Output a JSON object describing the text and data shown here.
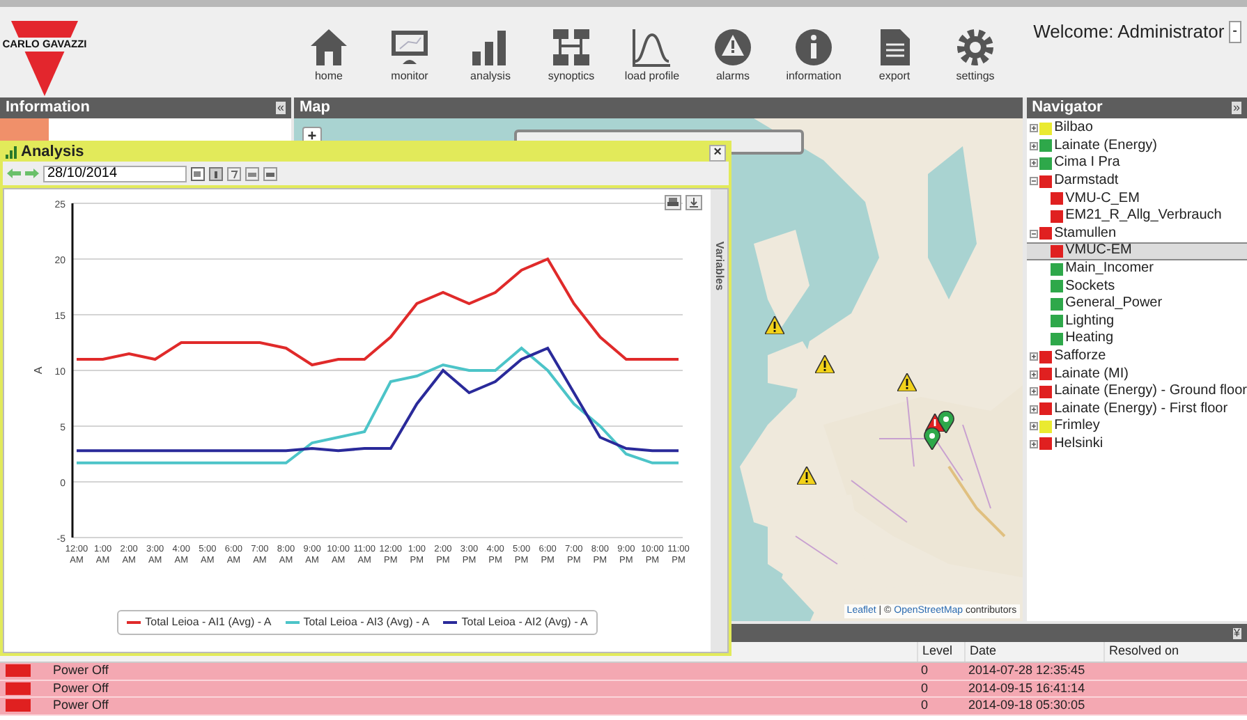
{
  "header": {
    "logo": "CARLO GAVAZZI",
    "nav": [
      {
        "label": "home"
      },
      {
        "label": "monitor"
      },
      {
        "label": "analysis"
      },
      {
        "label": "synoptics"
      },
      {
        "label": "load profile"
      },
      {
        "label": "alarms"
      },
      {
        "label": "information"
      },
      {
        "label": "export"
      },
      {
        "label": "settings"
      }
    ],
    "welcome": "Welcome: Administrator",
    "welcome_button": "-"
  },
  "panels": {
    "information": "Information",
    "information_collapse": "«",
    "map": "Map",
    "navigator": "Navigator",
    "navigator_collapse": "»",
    "alarms_collapse": "¥"
  },
  "map": {
    "zoom_in": "+",
    "attribution": [
      {
        "text": "Leaflet",
        "link": true
      },
      {
        "text": " | © ",
        "link": false
      },
      {
        "text": "OpenStreetMap",
        "link": true
      },
      {
        "text": " contributors",
        "link": false
      }
    ]
  },
  "analysis": {
    "title": "Analysis",
    "close": "×",
    "date": "28/10/2014",
    "variables_tab": "Variables",
    "chart_data": {
      "type": "line",
      "ylabel": "A",
      "categories": [
        "12:00 AM",
        "1:00 AM",
        "2:00 AM",
        "3:00 AM",
        "4:00 AM",
        "5:00 AM",
        "6:00 AM",
        "7:00 AM",
        "8:00 AM",
        "9:00 AM",
        "10:00 AM",
        "11:00 AM",
        "12:00 PM",
        "1:00 PM",
        "2:00 PM",
        "3:00 PM",
        "4:00 PM",
        "5:00 PM",
        "6:00 PM",
        "7:00 PM",
        "8:00 PM",
        "9:00 PM",
        "10:00 PM",
        "11:00 PM"
      ],
      "ylim": [
        -5,
        25
      ],
      "grid": true,
      "yticks": [
        -5,
        0,
        5,
        10,
        15,
        20,
        25
      ],
      "series": [
        {
          "name": "Total Leioa - AI1 (Avg) - A",
          "color": "#e02a2a",
          "values": [
            11,
            11,
            11.5,
            11,
            12.5,
            12.5,
            12.5,
            12.5,
            12,
            10.5,
            11,
            11,
            13,
            16,
            17,
            16,
            17,
            19,
            20,
            16,
            13,
            11,
            11,
            11
          ]
        },
        {
          "name": "Total Leioa - AI3 (Avg) - A",
          "color": "#4cc4c8",
          "values": [
            1.7,
            1.7,
            1.7,
            1.7,
            1.7,
            1.7,
            1.7,
            1.7,
            1.7,
            3.5,
            4,
            4.5,
            9,
            9.5,
            10.5,
            10,
            10,
            12,
            10,
            7,
            5,
            2.5,
            1.7,
            1.7
          ]
        },
        {
          "name": "Total Leioa - AI2 (Avg) - A",
          "color": "#2a2a9a",
          "values": [
            2.8,
            2.8,
            2.8,
            2.8,
            2.8,
            2.8,
            2.8,
            2.8,
            2.8,
            3,
            2.8,
            3,
            3,
            7,
            10,
            8,
            9,
            11,
            12,
            8,
            4,
            3,
            2.8,
            2.8
          ]
        }
      ]
    }
  },
  "alarms": {
    "columns": [
      "Level",
      "Date",
      "Resolved on"
    ],
    "rows": [
      {
        "color": "#e02020",
        "event": "Power Off",
        "level_text": "0",
        "date": "2014-07-28 12:35:45"
      },
      {
        "color": "#e02020",
        "event": "Power Off",
        "level_text": "0",
        "date": "2014-09-15 16:41:14"
      },
      {
        "color": "#e02020",
        "event": "Power Off",
        "level_text": "0",
        "date": "2014-09-18 05:30:05"
      }
    ]
  },
  "navigator": [
    {
      "label": "Bilbao",
      "color": "#eaea30",
      "expanded": false,
      "selected": false
    },
    {
      "label": "Lainate (Energy)",
      "color": "#2ea84a",
      "expanded": false,
      "selected": false
    },
    {
      "label": "Cima I Pra",
      "color": "#2ea84a",
      "expanded": false,
      "selected": false
    },
    {
      "label": "Darmstadt",
      "color": "#e02020",
      "expanded": true,
      "selected": false,
      "children": [
        {
          "label": "VMU-C_EM",
          "color": "#e02020",
          "selected": false
        },
        {
          "label": "EM21_R_Allg_Verbrauch",
          "color": "#e02020",
          "selected": false
        }
      ]
    },
    {
      "label": "Stamullen",
      "color": "#e02020",
      "expanded": true,
      "selected": false,
      "children": [
        {
          "label": "VMUC-EM",
          "color": "#e02020",
          "selected": true
        },
        {
          "label": "Main_Incomer",
          "color": "#2ea84a",
          "selected": false
        },
        {
          "label": "Sockets",
          "color": "#2ea84a",
          "selected": false
        },
        {
          "label": "General_Power",
          "color": "#2ea84a",
          "selected": false
        },
        {
          "label": "Lighting",
          "color": "#2ea84a",
          "selected": false
        },
        {
          "label": "Heating",
          "color": "#2ea84a",
          "selected": false
        }
      ]
    },
    {
      "label": "Safforze",
      "color": "#e02020",
      "expanded": false,
      "selected": false
    },
    {
      "label": "Lainate (MI)",
      "color": "#e02020",
      "expanded": false,
      "selected": false
    },
    {
      "label": "Lainate (Energy) - Ground floor",
      "color": "#e02020",
      "expanded": false,
      "selected": false
    },
    {
      "label": "Lainate (Energy) - First floor",
      "color": "#e02020",
      "expanded": false,
      "selected": false
    },
    {
      "label": "Frimley",
      "color": "#eaea30",
      "expanded": false,
      "selected": false
    },
    {
      "label": "Helsinki",
      "color": "#e02020",
      "expanded": false,
      "selected": false
    }
  ]
}
